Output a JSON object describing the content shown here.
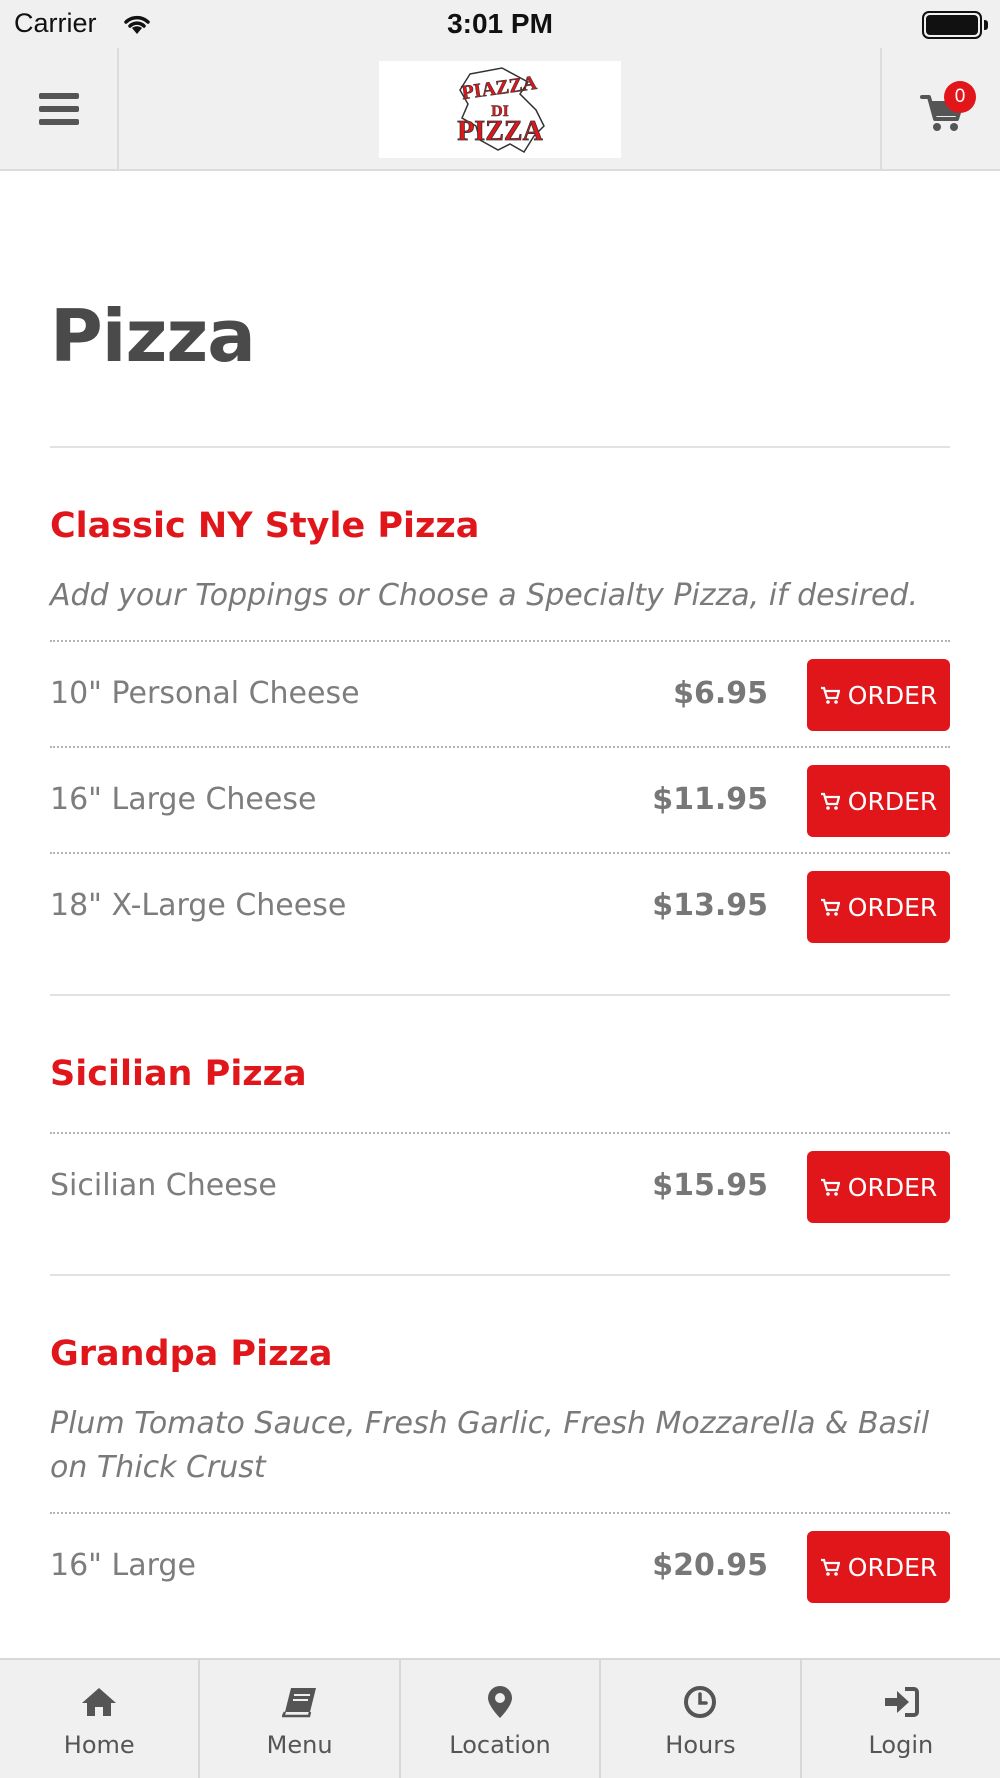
{
  "status_bar": {
    "carrier": "Carrier",
    "time": "3:01 PM"
  },
  "header": {
    "menu_icon": "hamburger-icon",
    "logo_text": [
      "PIAZZA",
      "DI",
      "PIZZA"
    ],
    "cart_icon": "cart-icon",
    "cart_count": "0"
  },
  "colors": {
    "accent": "#e0161b",
    "title": "#4a4a4a",
    "text": "#7d7d7d",
    "bar_bg": "#f0f0f0"
  },
  "page": {
    "title": "Pizza"
  },
  "sections": [
    {
      "title": "Classic NY Style Pizza",
      "description": "Add your Toppings or Choose a Specialty Pizza, if desired.",
      "items": [
        {
          "name": "10\" Personal Cheese",
          "price": "$6.95",
          "order_label": "ORDER"
        },
        {
          "name": "16\" Large Cheese",
          "price": "$11.95",
          "order_label": "ORDER"
        },
        {
          "name": "18\" X-Large Cheese",
          "price": "$13.95",
          "order_label": "ORDER"
        }
      ]
    },
    {
      "title": "Sicilian Pizza",
      "description": "",
      "items": [
        {
          "name": "Sicilian Cheese",
          "price": "$15.95",
          "order_label": "ORDER"
        }
      ]
    },
    {
      "title": "Grandpa Pizza",
      "description": "Plum Tomato Sauce, Fresh Garlic, Fresh Mozzarella & Basil on Thick Crust",
      "items": [
        {
          "name": "16\" Large",
          "price": "$20.95",
          "order_label": "ORDER"
        }
      ]
    }
  ],
  "tab_bar": [
    {
      "label": "Home",
      "icon": "home-icon"
    },
    {
      "label": "Menu",
      "icon": "book-icon"
    },
    {
      "label": "Location",
      "icon": "map-pin-icon"
    },
    {
      "label": "Hours",
      "icon": "clock-icon"
    },
    {
      "label": "Login",
      "icon": "sign-in-icon"
    }
  ]
}
